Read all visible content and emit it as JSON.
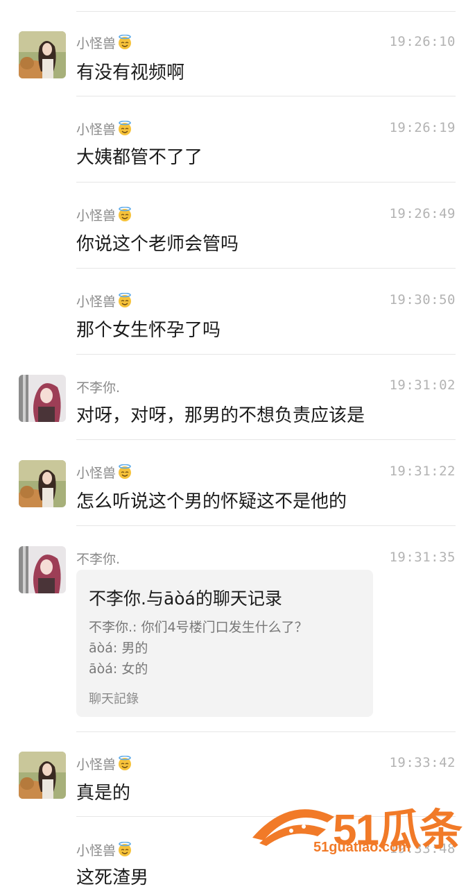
{
  "messages": [
    {
      "name": "小怪兽",
      "time": "19:26:10",
      "text": "有没有视频啊",
      "avatar": "girl-with-dog"
    },
    {
      "name": "小怪兽",
      "time": "19:26:19",
      "text": "大姨都管不了了",
      "avatar": ""
    },
    {
      "name": "小怪兽",
      "time": "19:26:49",
      "text": "你说这个老师会管吗",
      "avatar": ""
    },
    {
      "name": "小怪兽",
      "time": "19:30:50",
      "text": "那个女生怀孕了吗",
      "avatar": ""
    },
    {
      "name": "不李你.",
      "time": "19:31:02",
      "text": "对呀，对呀，那男的不想负责应该是",
      "avatar": "pink-hair-girl"
    },
    {
      "name": "小怪兽",
      "time": "19:31:22",
      "text": "怎么听说这个男的怀疑这不是他的",
      "avatar": "girl-with-dog"
    },
    {
      "name": "不李你.",
      "time": "19:31:35",
      "text": "",
      "avatar": "pink-hair-girl"
    },
    {
      "name": "小怪兽",
      "time": "19:33:42",
      "text": "真是的",
      "avatar": "girl-with-dog"
    },
    {
      "name": "小怪兽",
      "time": "19:33:48",
      "text": "这死渣男",
      "avatar": ""
    }
  ],
  "forward_card": {
    "title": "不李你.与āòá的聊天记录",
    "lines": [
      "不李你.: 你们4号楼门口发生什么了？",
      "āòá: 男的",
      "āòá: 女的"
    ],
    "footer": "聊天記錄"
  },
  "watermark": {
    "brand": "51瓜条",
    "url": "51guatiao.com",
    "color": "#f17a28"
  },
  "icons": {
    "name_badge": "halo-smile-emoji"
  }
}
